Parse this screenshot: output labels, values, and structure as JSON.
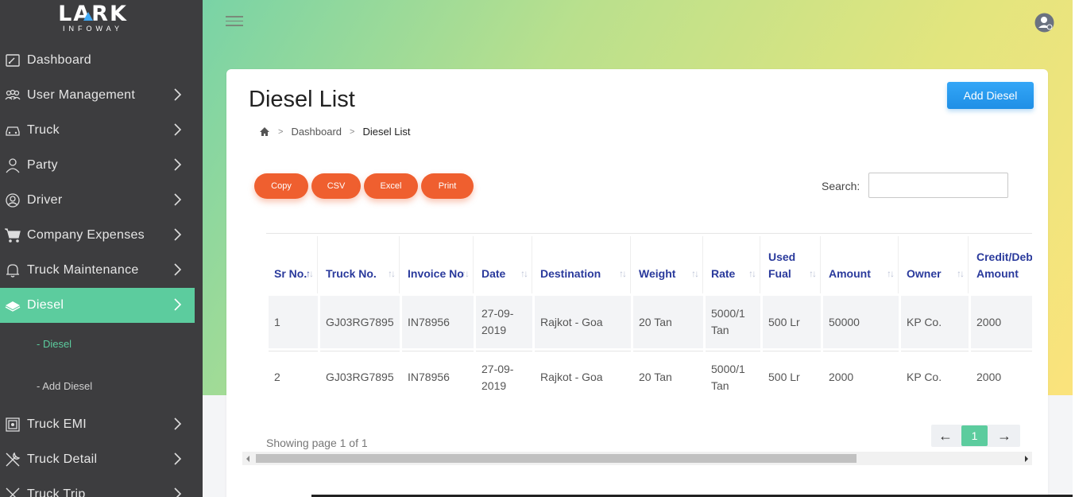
{
  "brand": {
    "name": "LARK",
    "tagline": "INFOWAY"
  },
  "sidebar": {
    "items": [
      {
        "label": "Dashboard",
        "icon": "dashboard-icon",
        "chevron": false
      },
      {
        "label": "User Management",
        "icon": "users-icon",
        "chevron": true
      },
      {
        "label": "Truck",
        "icon": "car-icon",
        "chevron": true
      },
      {
        "label": "Party",
        "icon": "person-icon",
        "chevron": true
      },
      {
        "label": "Driver",
        "icon": "driver-icon",
        "chevron": true
      },
      {
        "label": "Company Expenses",
        "icon": "cart-icon",
        "chevron": true
      },
      {
        "label": "Truck Maintenance",
        "icon": "bell-icon",
        "chevron": true
      },
      {
        "label": "Diesel",
        "icon": "money-icon",
        "chevron": true,
        "active": true
      },
      {
        "label": "Truck EMI",
        "icon": "safe-icon",
        "chevron": true
      },
      {
        "label": "Truck Detail",
        "icon": "tools-icon",
        "chevron": true
      },
      {
        "label": "Truck Trip",
        "icon": "route-icon",
        "chevron": true
      }
    ],
    "subitems": [
      {
        "label": "- Diesel",
        "active": true
      },
      {
        "label": "- Add Diesel",
        "active": false
      }
    ]
  },
  "page": {
    "title": "Diesel List",
    "add_button": "Add Diesel",
    "breadcrumb": {
      "home": "Dashboard",
      "current": "Diesel List"
    }
  },
  "export_buttons": [
    "Copy",
    "CSV",
    "Excel",
    "Print"
  ],
  "search": {
    "label": "Search:",
    "value": ""
  },
  "table": {
    "headers": [
      "Sr No.",
      "Truck No.",
      "Invoice No",
      "Date",
      "Destination",
      "Weight",
      "Rate",
      "Used Fual",
      "Amount",
      "Owner",
      "Credit/Debit Amount"
    ],
    "rows": [
      [
        "1",
        "GJ03RG7895",
        "IN78956",
        "27-09-2019",
        "Rajkot - Goa",
        "20 Tan",
        "5000/1 Tan",
        "500 Lr",
        "50000",
        "KP Co.",
        "2000"
      ],
      [
        "2",
        "GJ03RG7895",
        "IN78956",
        "27-09-2019",
        "Rajkot - Goa",
        "20 Tan",
        "5000/1 Tan",
        "500 Lr",
        "2000",
        "KP Co.",
        "2000"
      ]
    ]
  },
  "pagination": {
    "showing": "Showing page 1 of 1",
    "current": "1",
    "prev": "←",
    "next": "→"
  },
  "colors": {
    "accent": "#5ccc9e",
    "primary": "#1f8fe6",
    "export": "#ef5f2f",
    "sidebar": "#3d3d3f"
  }
}
